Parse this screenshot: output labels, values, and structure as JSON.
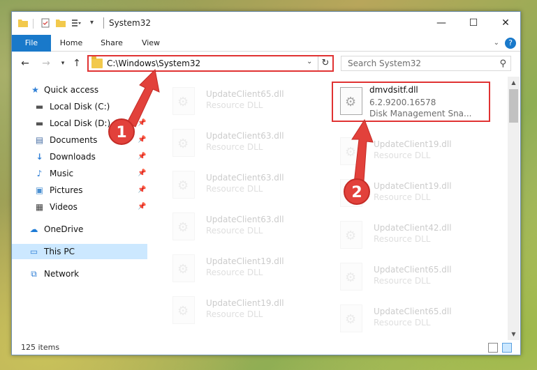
{
  "window": {
    "title": "System32",
    "controls": {
      "minimize": "—",
      "maximize": "☐",
      "close": "✕"
    }
  },
  "ribbon": {
    "tabs": [
      "File",
      "Home",
      "Share",
      "View"
    ],
    "help": "?"
  },
  "navbar": {
    "address": "C:\\Windows\\System32",
    "search_placeholder": "Search System32"
  },
  "sidebar": {
    "items": [
      {
        "label": "Quick access",
        "icon": "star-icon",
        "pinned": false
      },
      {
        "label": "Local Disk (C:)",
        "icon": "drive-icon",
        "pinned": true
      },
      {
        "label": "Local Disk (D:)",
        "icon": "drive-icon",
        "pinned": true
      },
      {
        "label": "Documents",
        "icon": "documents-icon",
        "pinned": true
      },
      {
        "label": "Downloads",
        "icon": "download-icon",
        "pinned": true
      },
      {
        "label": "Music",
        "icon": "music-icon",
        "pinned": true
      },
      {
        "label": "Pictures",
        "icon": "pictures-icon",
        "pinned": true
      },
      {
        "label": "Videos",
        "icon": "videos-icon",
        "pinned": true
      },
      {
        "label": "OneDrive",
        "icon": "cloud-icon",
        "pinned": false
      },
      {
        "label": "This PC",
        "icon": "computer-icon",
        "pinned": false,
        "selected": true
      },
      {
        "label": "Network",
        "icon": "network-icon",
        "pinned": false
      }
    ]
  },
  "files": {
    "left": [
      {
        "name": "UpdateClient65.dll",
        "type": "Resource DLL"
      },
      {
        "name": "UpdateClient63.dll",
        "type": "Resource DLL"
      },
      {
        "name": "UpdateClient63.dll",
        "type": "Resource DLL"
      },
      {
        "name": "UpdateClient63.dll",
        "type": "Resource DLL"
      },
      {
        "name": "UpdateClient19.dll",
        "type": "Resource DLL"
      },
      {
        "name": "UpdateClient19.dll",
        "type": "Resource DLL"
      }
    ],
    "highlighted": {
      "name": "dmvdsitf.dll",
      "version": "6.2.9200.16578",
      "description": "Disk Management Sna..."
    },
    "right": [
      {
        "name": "UpdateClient19.dll",
        "type": "Resource DLL"
      },
      {
        "name": "UpdateClient19.dll",
        "type": "Resource DLL"
      },
      {
        "name": "UpdateClient42.dll",
        "type": "Resource DLL"
      },
      {
        "name": "UpdateClient65.dll",
        "type": "Resource DLL"
      },
      {
        "name": "UpdateClient65.dll",
        "type": "Resource DLL"
      }
    ]
  },
  "status": {
    "items": "125 items"
  },
  "annotations": {
    "step1": "1",
    "step2": "2",
    "color": "#e2413b"
  }
}
